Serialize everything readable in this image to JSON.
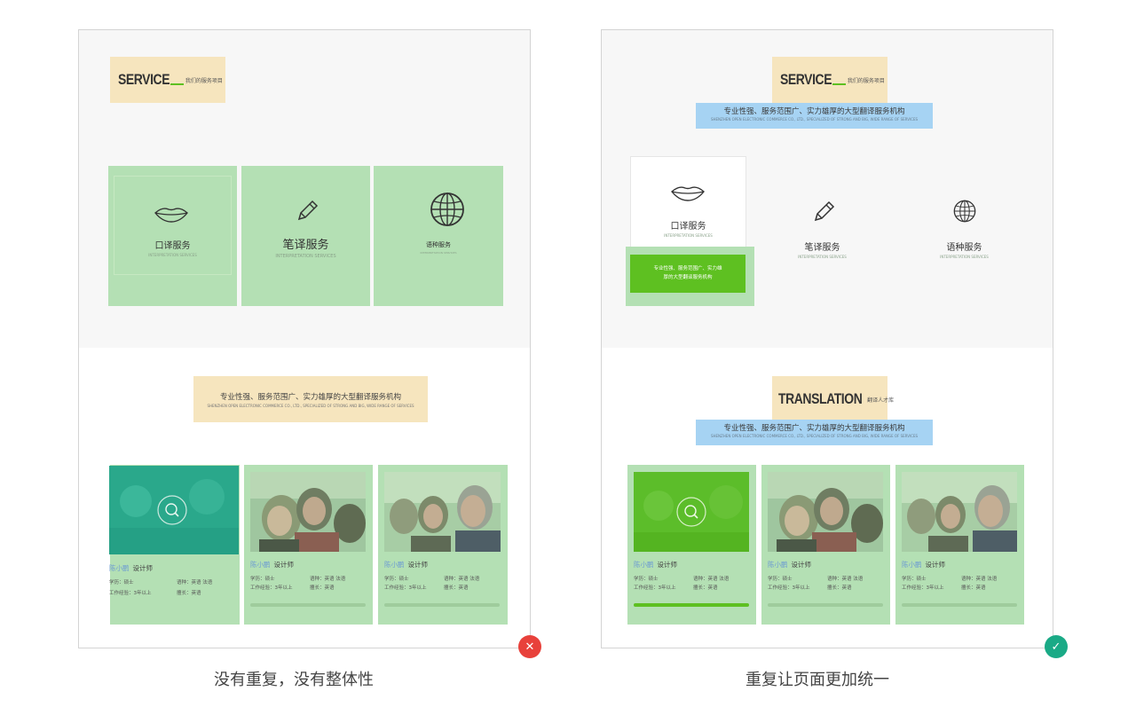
{
  "left_panel": {
    "service_tag": {
      "big": "SERVICE",
      "small": "我们的服务项目"
    },
    "services": [
      {
        "cn": "口译服务",
        "en": "INTERPRETATION SERVICES"
      },
      {
        "cn": "笔译服务",
        "en": "INTERPRETATION SERVICES"
      },
      {
        "cn": "语种服务",
        "en": "INTERPRETATION SERVICES"
      }
    ],
    "slogan": {
      "cn": "专业性强、服务范围广、实力雄厚的大型翻译服务机构",
      "en": "SHENZHEN OPEN ELECTRONIC COMMERCE CO., LTD., SPECIALIZED OF STRONG AND BIG, WIDE RANGE OF SERVICES"
    },
    "people": [
      {
        "name": "陈小鹏",
        "role": "设计师",
        "edu": "学历：硕士",
        "lang": "语种：英语  法语",
        "exp": "工作经验：3年以上",
        "good": "擅长：英语"
      },
      {
        "name": "陈小鹏",
        "role": "设计师",
        "edu": "学历：硕士",
        "lang": "语种：英语  法语",
        "exp": "工作经验：3年以上",
        "good": "擅长：英语"
      },
      {
        "name": "陈小鹏",
        "role": "设计师",
        "edu": "学历：硕士",
        "lang": "语种：英语  法语",
        "exp": "工作经验：3年以上",
        "good": "擅长：英语"
      }
    ],
    "caption": "没有重复，没有整体性"
  },
  "right_panel": {
    "service_tag": {
      "big": "SERVICE",
      "small": "我们的服务项目"
    },
    "service_slogan": {
      "cn": "专业性强、服务范围广、实力雄厚的大型翻译服务机构",
      "en": "SHENZHEN OPEN ELECTRONIC COMMERCE CO., LTD., SPECIALIZED OF STRONG AND BIG, WIDE RANGE OF SERVICES"
    },
    "services": [
      {
        "cn": "口译服务",
        "en": "INTERPRETATION SERVICES"
      },
      {
        "cn": "笔译服务",
        "en": "INTERPRETATION SERVICES"
      },
      {
        "cn": "语种服务",
        "en": "INTERPRETATION SERVICES"
      }
    ],
    "hover_text": "专业性强、服务范围广、实力雄厚的大型翻译服务机构",
    "translation_tag": {
      "big": "TRANSLATION",
      "small": "翻译人才库"
    },
    "translation_slogan": {
      "cn": "专业性强、服务范围广、实力雄厚的大型翻译服务机构",
      "en": "SHENZHEN OPEN ELECTRONIC COMMERCE CO., LTD., SPECIALIZED OF STRONG AND BIG, WIDE RANGE OF SERVICES"
    },
    "people": [
      {
        "name": "陈小鹏",
        "role": "设计师",
        "edu": "学历：硕士",
        "lang": "语种：英语  法语",
        "exp": "工作经验：3年以上",
        "good": "擅长：英语"
      },
      {
        "name": "陈小鹏",
        "role": "设计师",
        "edu": "学历：硕士",
        "lang": "语种：英语  法语",
        "exp": "工作经验：3年以上",
        "good": "擅长：英语"
      },
      {
        "name": "陈小鹏",
        "role": "设计师",
        "edu": "学历：硕士",
        "lang": "语种：英语  法语",
        "exp": "工作经验：3年以上",
        "good": "擅长：英语"
      }
    ],
    "caption": "重复让页面更加统一"
  },
  "marks": {
    "bad": "✕",
    "good": "✓",
    "bad_color": "#e8413b",
    "good_color": "#1aaa86"
  },
  "colors": {
    "tag": "#f6e5be",
    "blue": "#a6d3f3",
    "green_overlay": "#b4e0b4",
    "accent": "#5ec021"
  }
}
